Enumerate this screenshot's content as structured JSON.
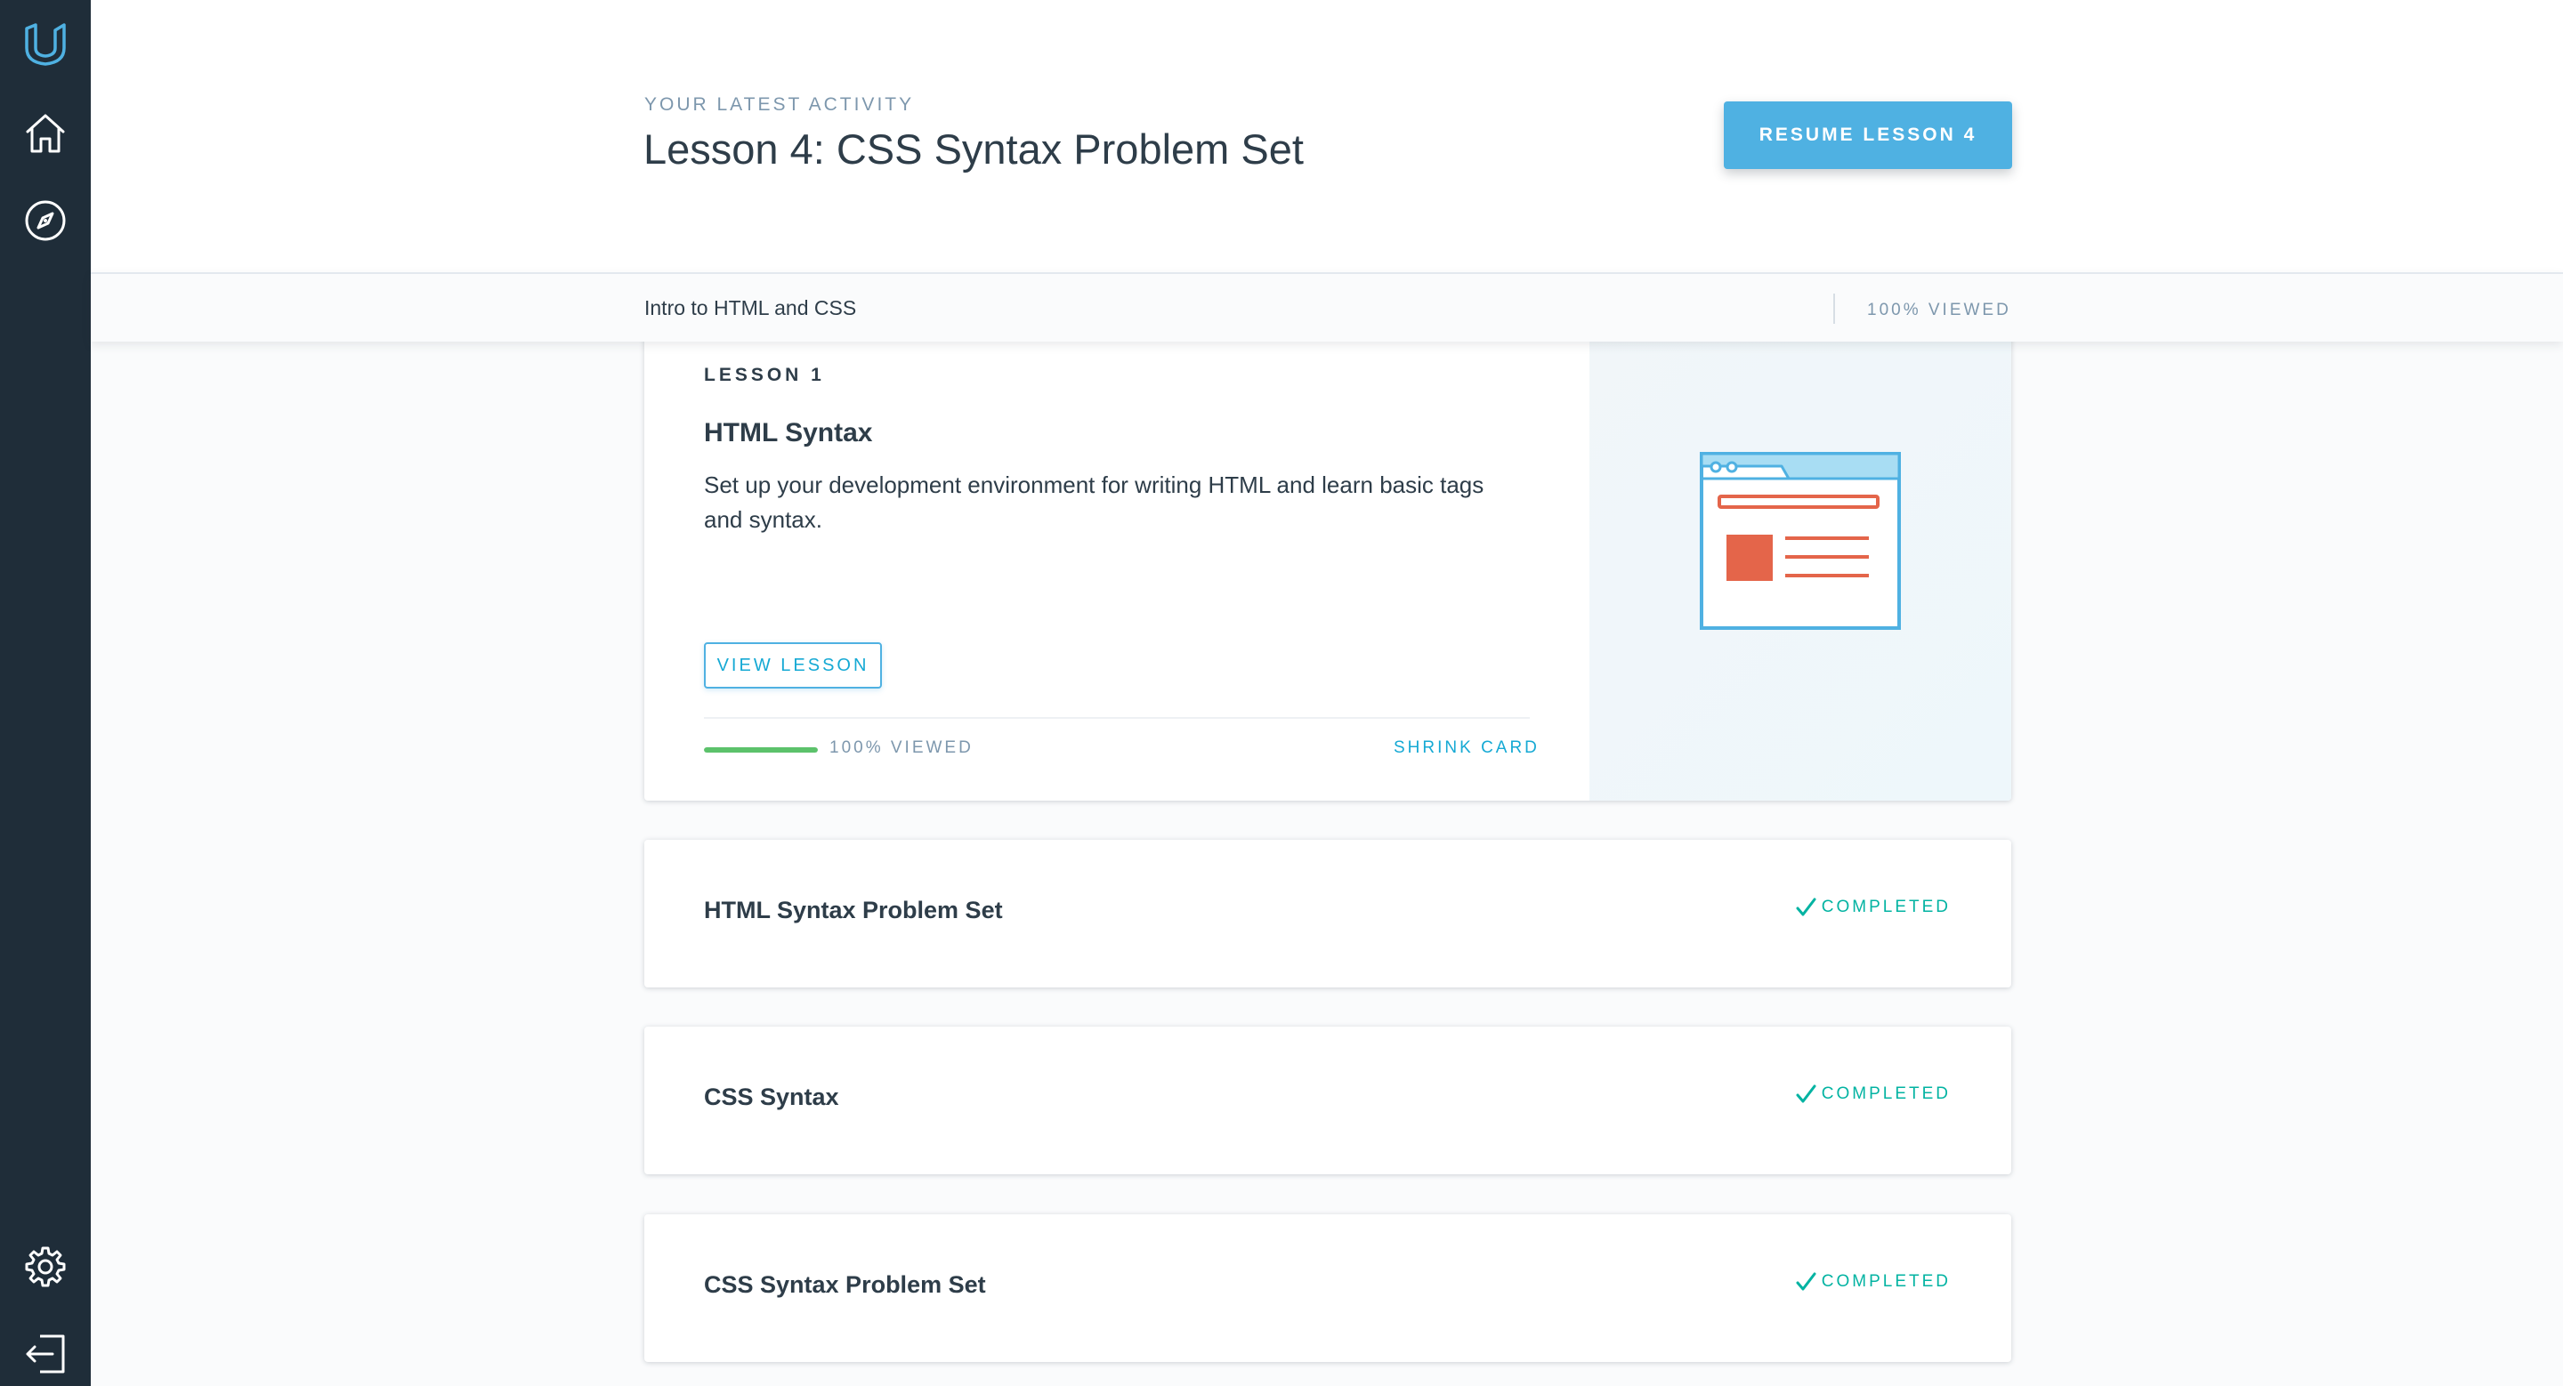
{
  "sidebar": {
    "top_icons": [
      "udacity-logo-icon",
      "home-icon",
      "compass-icon"
    ],
    "bottom_icons": [
      "gear-icon",
      "logout-icon"
    ],
    "colors": {
      "background": "#1f2d39",
      "logo": "#4fb1e2",
      "icon": "#ffffff"
    }
  },
  "header": {
    "latest_label": "YOUR LATEST ACTIVITY",
    "latest_title": "Lesson 4: CSS Syntax Problem Set",
    "resume_button": "RESUME LESSON 4",
    "accent_color": "#4fb1e2"
  },
  "course_bar": {
    "course_name": "Intro to HTML and CSS",
    "viewed_text": "100% VIEWED"
  },
  "expanded_lesson": {
    "label": "LESSON 1",
    "title": "HTML Syntax",
    "description": "Set up your development environment for writing HTML and learn basic tags and syntax.",
    "view_button": "VIEW LESSON",
    "progress_fraction": 1.0,
    "progress_text": "100% VIEWED",
    "shrink_link": "SHRINK CARD",
    "illustration_icon": "browser-window-icon",
    "progress_color": "#5cc26b"
  },
  "lessons": [
    {
      "title": "HTML Syntax Problem Set",
      "status": "COMPLETED",
      "status_icon": "checkmark-icon"
    },
    {
      "title": "CSS Syntax",
      "status": "COMPLETED",
      "status_icon": "checkmark-icon"
    },
    {
      "title": "CSS Syntax Problem Set",
      "status": "COMPLETED",
      "status_icon": "checkmark-icon"
    }
  ],
  "status_color": "#02b3a2"
}
